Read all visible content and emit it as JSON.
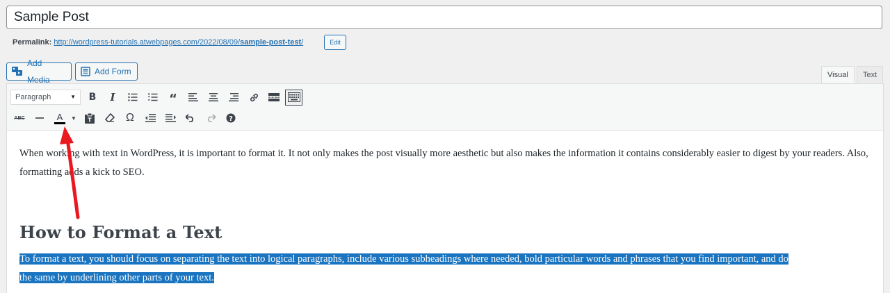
{
  "post": {
    "title": "Sample Post"
  },
  "permalink": {
    "label": "Permalink:",
    "url_prefix": "http://wordpress-tutorials.atwebpages.com/2022/08/09/",
    "url_slug": "sample-post-test",
    "url_suffix": "/",
    "edit_label": "Edit"
  },
  "media_buttons": {
    "add_media": "Add Media",
    "add_form": "Add Form"
  },
  "editor_tabs": {
    "visual": "Visual",
    "text": "Text",
    "active": "visual"
  },
  "toolbar": {
    "format_select": "Paragraph",
    "row1": [
      "bold-icon",
      "italic-icon",
      "bulleted-list-icon",
      "numbered-list-icon",
      "blockquote-icon",
      "align-left-icon",
      "align-center-icon",
      "align-right-icon",
      "link-icon",
      "read-more-icon",
      "toolbar-toggle-icon"
    ],
    "row2": [
      "strikethrough-icon",
      "horizontal-line-icon",
      "text-color-icon",
      "text-color-dropdown-icon",
      "paste-as-text-icon",
      "clear-formatting-icon",
      "special-character-icon",
      "outdent-icon",
      "indent-icon",
      "undo-icon",
      "redo-icon",
      "help-icon"
    ]
  },
  "content": {
    "paragraph1": "When working with text in WordPress, it is important to format it. It not only makes the post visually more aesthetic but also makes the information it contains considerably easier to digest by your readers. Also, formatting adds a kick to SEO.",
    "heading": "How to Format a Text",
    "paragraph2_line1": "To format a text, you should focus on separating the text into logical paragraphs, include various subheadings where needed, bold particular words and phrases that you find important, and do",
    "paragraph2_line2": "the same by underlining other parts of your text."
  },
  "colors": {
    "accent": "#2271b1",
    "selection": "#1a74c0",
    "annotation_arrow": "#e8191f"
  }
}
